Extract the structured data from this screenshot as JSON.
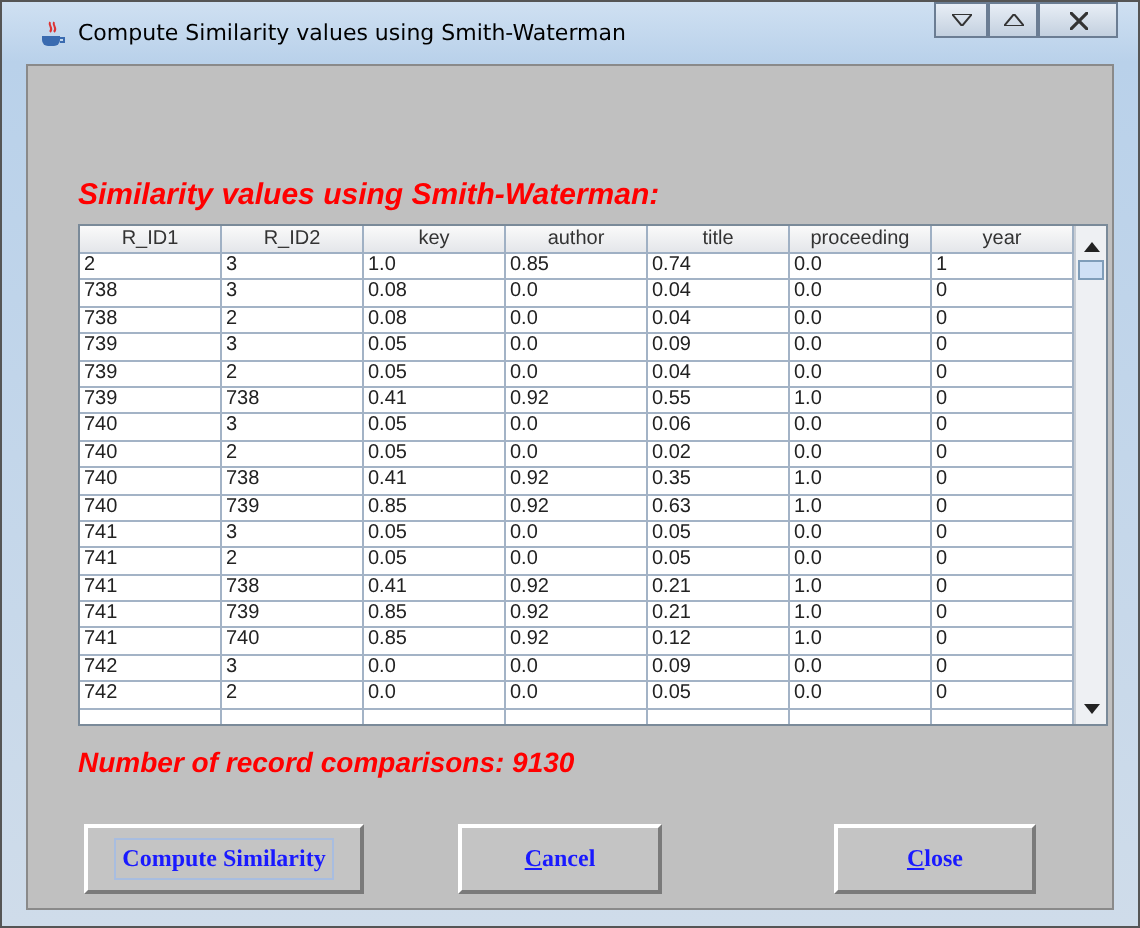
{
  "window": {
    "title": "Compute Similarity values using Smith-Waterman"
  },
  "heading": "Similarity values using Smith-Waterman:",
  "table": {
    "columns": [
      "R_ID1",
      "R_ID2",
      "key",
      "author",
      "title",
      "proceeding",
      "year"
    ],
    "rows": [
      [
        "2",
        "3",
        "1.0",
        "0.85",
        "0.74",
        "0.0",
        "1"
      ],
      [
        "738",
        "3",
        "0.08",
        "0.0",
        "0.04",
        "0.0",
        "0"
      ],
      [
        "738",
        "2",
        "0.08",
        "0.0",
        "0.04",
        "0.0",
        "0"
      ],
      [
        "739",
        "3",
        "0.05",
        "0.0",
        "0.09",
        "0.0",
        "0"
      ],
      [
        "739",
        "2",
        "0.05",
        "0.0",
        "0.04",
        "0.0",
        "0"
      ],
      [
        "739",
        "738",
        "0.41",
        "0.92",
        "0.55",
        "1.0",
        "0"
      ],
      [
        "740",
        "3",
        "0.05",
        "0.0",
        "0.06",
        "0.0",
        "0"
      ],
      [
        "740",
        "2",
        "0.05",
        "0.0",
        "0.02",
        "0.0",
        "0"
      ],
      [
        "740",
        "738",
        "0.41",
        "0.92",
        "0.35",
        "1.0",
        "0"
      ],
      [
        "740",
        "739",
        "0.85",
        "0.92",
        "0.63",
        "1.0",
        "0"
      ],
      [
        "741",
        "3",
        "0.05",
        "0.0",
        "0.05",
        "0.0",
        "0"
      ],
      [
        "741",
        "2",
        "0.05",
        "0.0",
        "0.05",
        "0.0",
        "0"
      ],
      [
        "741",
        "738",
        "0.41",
        "0.92",
        "0.21",
        "1.0",
        "0"
      ],
      [
        "741",
        "739",
        "0.85",
        "0.92",
        "0.21",
        "1.0",
        "0"
      ],
      [
        "741",
        "740",
        "0.85",
        "0.92",
        "0.12",
        "1.0",
        "0"
      ],
      [
        "742",
        "3",
        "0.0",
        "0.0",
        "0.09",
        "0.0",
        "0"
      ],
      [
        "742",
        "2",
        "0.0",
        "0.0",
        "0.05",
        "0.0",
        "0"
      ]
    ]
  },
  "count": "Number of record comparisons: 9130",
  "buttons": [
    {
      "label": "Compute Similarity",
      "focused": true,
      "underline_first": false
    },
    {
      "label": "Cancel",
      "focused": false,
      "underline_first": true
    },
    {
      "label": "Close",
      "focused": false,
      "underline_first": true
    }
  ]
}
